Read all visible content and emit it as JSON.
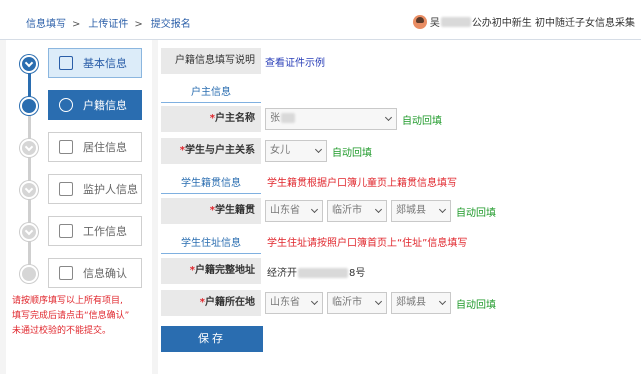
{
  "breadcrumb": {
    "items": [
      "信息填写",
      "上传证件",
      "提交报名"
    ],
    "sep": ">"
  },
  "user": {
    "name_prefix": "吴",
    "name_suffix": "公办初中新生 初中随迁子女信息采集"
  },
  "steps": [
    {
      "label": "基本信息",
      "state": "current",
      "icon": "document-edit-icon"
    },
    {
      "label": "户籍信息",
      "state": "active",
      "icon": "person-icon"
    },
    {
      "label": "居住信息",
      "state": "todo",
      "icon": "home-icon"
    },
    {
      "label": "监护人信息",
      "state": "todo",
      "icon": "guardian-icon"
    },
    {
      "label": "工作信息",
      "state": "todo",
      "icon": "clipboard-icon"
    },
    {
      "label": "信息确认",
      "state": "todo",
      "icon": "hourglass-icon"
    }
  ],
  "sidebar_note": [
    "请按顺序填写以上所有项目,",
    "填写完成后请点击“信息确认”",
    "未通过校验的不能提交。"
  ],
  "form": {
    "help_label": "户籍信息填写说明",
    "help_link": "查看证件示例",
    "section_household": "户主信息",
    "owner_name_label": "户主名称",
    "owner_name_value": "张",
    "relation_label": "学生与户主关系",
    "relation_value": "女儿",
    "section_native": "学生籍贯信息",
    "native_warn": "学生籍贯根据户口簿儿童页上籍贯信息填写",
    "native_label": "学生籍贯",
    "native_province": "山东省",
    "native_city": "临沂市",
    "native_county": "郯城县",
    "section_address": "学生住址信息",
    "address_warn": "学生住址请按照户口簿首页上“住址”信息填写",
    "address_label": "户籍完整地址",
    "address_prefix": "经济开",
    "address_suffix": "8号",
    "location_label": "户籍所在地",
    "loc_province": "山东省",
    "loc_city": "临沂市",
    "loc_county": "郯城县",
    "auto_fill": "自动回填",
    "required_mark": "*",
    "save": "保存"
  }
}
